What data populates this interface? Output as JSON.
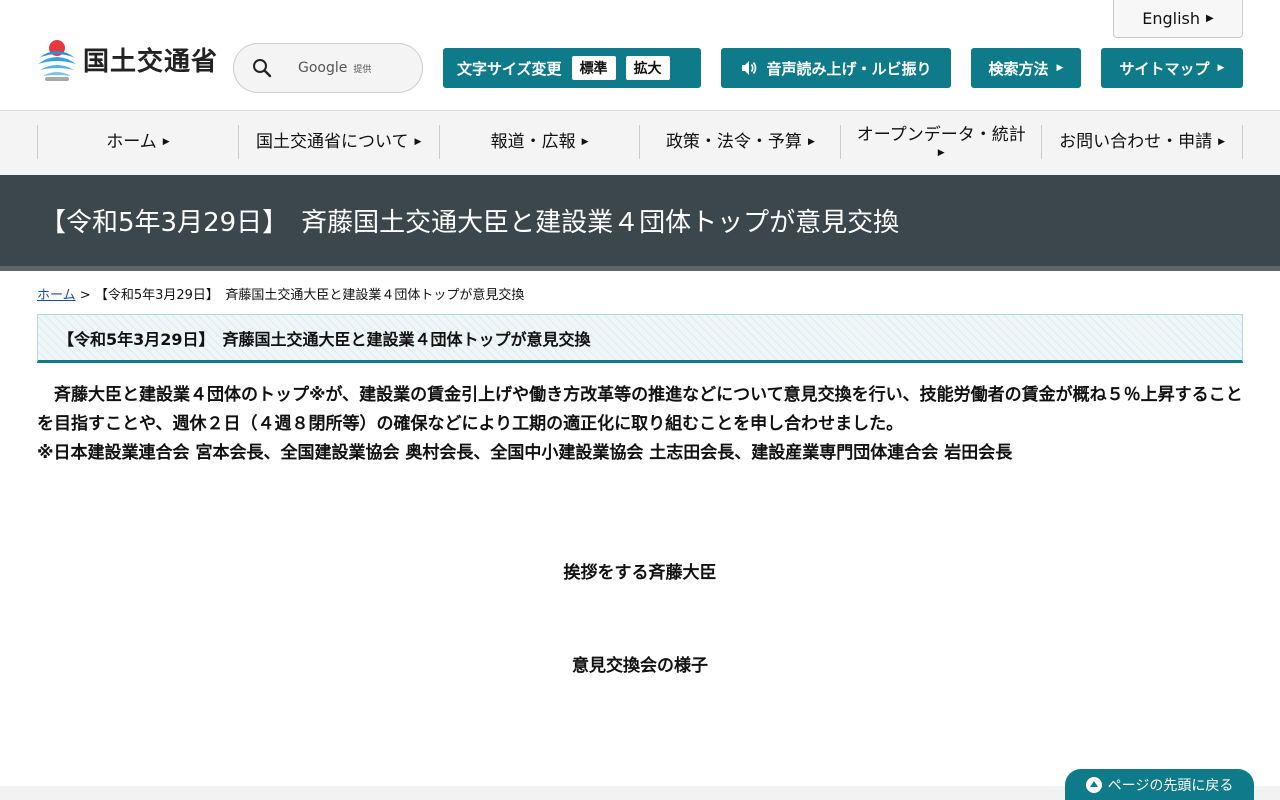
{
  "header": {
    "english_label": "English",
    "logo_text": "国土交通省",
    "search": {
      "provider": "Google",
      "provider_sub": "提供"
    },
    "font_size": {
      "label": "文字サイズ変更",
      "options": [
        "標準",
        "拡大"
      ]
    },
    "voice_label": "音声読み上げ・ルビ振り",
    "search_method_label": "検索方法",
    "sitemap_label": "サイトマップ",
    "brand_color": "#0f7b8a"
  },
  "nav": {
    "items": [
      {
        "label": "ホーム"
      },
      {
        "label": "国土交通省について"
      },
      {
        "label": "報道・広報"
      },
      {
        "label": "政策・法令・予算"
      },
      {
        "label": "オープンデータ・統計"
      },
      {
        "label": "お問い合わせ・申請"
      }
    ]
  },
  "page": {
    "title": "【令和5年3月29日】　斉藤国土交通大臣と建設業４団体トップが意見交換",
    "breadcrumb_home": "ホーム",
    "breadcrumb_sep": ">",
    "breadcrumb_current": "【令和5年3月29日】　斉藤国土交通大臣と建設業４団体トップが意見交換",
    "section_heading": "【令和5年3月29日】　斉藤国土交通大臣と建設業４団体トップが意見交換",
    "body": "斉藤大臣と建設業４団体のトップ※が、建設業の賃金引上げや働き方改革等の推進などについて意見交換を行い、技能労働者の賃金が概ね５％上昇することを目指すことや、週休２日（４週８閉所等）の確保などにより工期の適正化に取り組むことを申し合わせました。",
    "note": "※日本建設業連合会 宮本会長、全国建設業協会 奥村会長、全国中小建設業協会 土志田会長、建設産業専門団体連合会 岩田会長",
    "caption1": "挨拶をする斉藤大臣",
    "caption2": "意見交換会の様子"
  },
  "pagetop_label": "ページの先頭に戻る"
}
